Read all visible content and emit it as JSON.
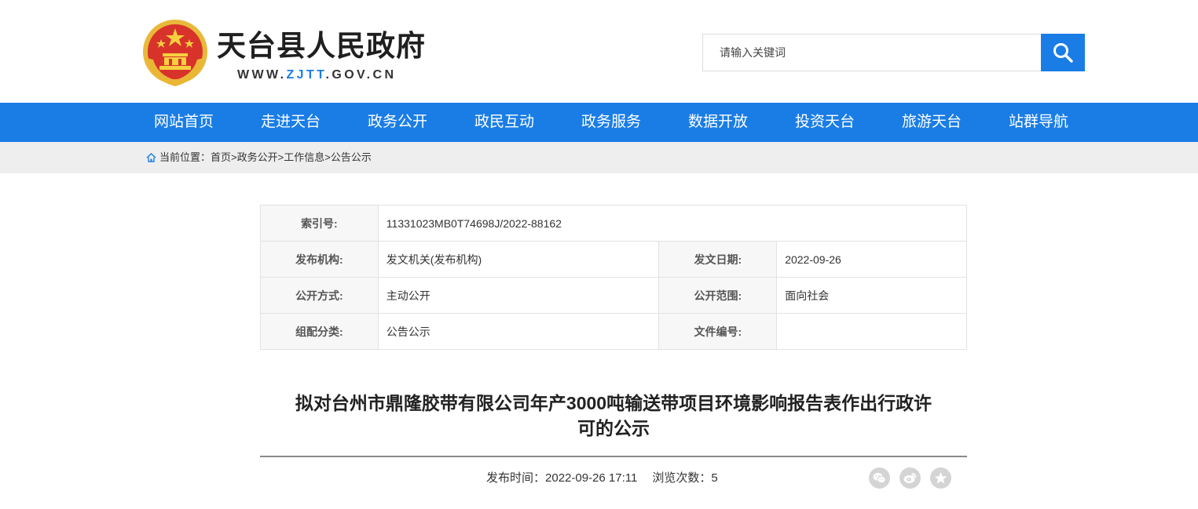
{
  "header": {
    "site_name": "天台县人民政府",
    "url_prefix": "WWW.",
    "url_highlight": "ZJTT",
    "url_suffix": ".GOV.CN",
    "search_placeholder": "请输入关键词"
  },
  "nav": {
    "items": [
      {
        "label": "网站首页"
      },
      {
        "label": "走进天台"
      },
      {
        "label": "政务公开"
      },
      {
        "label": "政民互动"
      },
      {
        "label": "政务服务"
      },
      {
        "label": "数据开放"
      },
      {
        "label": "投资天台"
      },
      {
        "label": "旅游天台"
      },
      {
        "label": "站群导航"
      }
    ]
  },
  "breadcrumb": {
    "prefix": "当前位置：",
    "items": [
      "首页",
      "政务公开",
      "工作信息",
      "公告公示"
    ],
    "separator": ">"
  },
  "info": {
    "index_no_label": "索引号:",
    "index_no": "11331023MB0T74698J/2022-88162",
    "publisher_label": "发布机构:",
    "publisher": "发文机关(发布机构)",
    "date_label": "发文日期:",
    "date": "2022-09-26",
    "method_label": "公开方式:",
    "method": "主动公开",
    "scope_label": "公开范围:",
    "scope": "面向社会",
    "category_label": "组配分类:",
    "category": "公告公示",
    "doc_no_label": "文件编号:",
    "doc_no": ""
  },
  "article": {
    "title_line1": "拟对台州市鼎隆胶带有限公司年产3000吨输送带项目环境影响报告表作出行政许",
    "title_line2": "可的公示",
    "publish_label": "发布时间：",
    "publish_time": "2022-09-26 17:11",
    "views_label": "浏览次数：",
    "views": "5"
  },
  "share": {
    "icons": [
      "wechat-icon",
      "weibo-icon",
      "favorite-icon"
    ]
  },
  "colors": {
    "brand_blue": "#1a7de6",
    "crumb_bg": "#eeeeee",
    "table_key_bg": "#f7f7f7",
    "share_icon_bg": "#d4d4d4"
  }
}
